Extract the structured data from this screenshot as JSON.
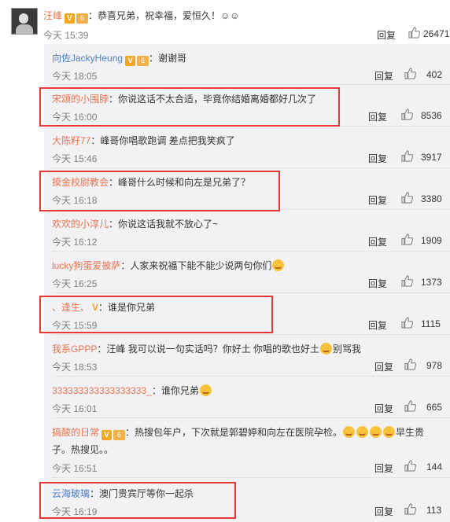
{
  "top": {
    "user": "汪峰",
    "text": "：恭喜兄弟，祝幸福，爱恒久！☺︎☺︎",
    "time": "今天 15:39",
    "reply_label": "回复",
    "likes": "26471"
  },
  "badges": {
    "v": "V",
    "level": "6"
  },
  "reply_label": "回复",
  "replies": [
    {
      "user": "向佐JackyHeung",
      "text": "：谢谢哥",
      "time": "今天 18:05",
      "likes": "402",
      "verified": true
    },
    {
      "user": "宋颂的小围脖",
      "text": "：你说这话不太合适，毕竟你结婚离婚都好几次了",
      "time": "今天 16:00",
      "likes": "8536"
    },
    {
      "user": "大陈籽77",
      "text": "：峰哥你唱歌跑调 差点把我笑疯了",
      "time": "今天 15:46",
      "likes": "3917"
    },
    {
      "user": "摸金校尉教会",
      "text": "：峰哥什么时候和向左是兄弟了？",
      "time": "今天 16:18",
      "likes": "3380"
    },
    {
      "user": "欢欢的小淳儿",
      "text": "：你说这话我就不放心了~",
      "time": "今天 16:12",
      "likes": "1909"
    },
    {
      "user": "lucky狗蛋爱披萨",
      "text": "：人家来祝福下能不能少说两句你们",
      "time": "今天 16:25",
      "likes": "1373"
    },
    {
      "user": "、逢生、",
      "text": "：谁是你兄弟",
      "time": "今天 15:59",
      "likes": "1115"
    },
    {
      "user": "我系GPPP",
      "text": "：汪峰 我可以说一句实话吗？你好土 你唱的歌也好土",
      "text_tail": "别骂我",
      "time": "今天 18:53",
      "likes": "978"
    },
    {
      "user": "333333333333333333_",
      "text": "：谁你兄弟",
      "time": "今天 16:01",
      "likes": "665"
    },
    {
      "user": "搞酸的日常",
      "text": "：热搜包年户，下次就是郭碧婷和向左在医院孕检。",
      "text_tail": "早生贵",
      "text_line2": "子。热搜见。。",
      "time": "今天 16:51",
      "likes": "144"
    },
    {
      "user": "云海玻璃",
      "text": "：澳门贵宾厅等你一起杀",
      "time": "今天 16:19",
      "likes": "113"
    }
  ]
}
